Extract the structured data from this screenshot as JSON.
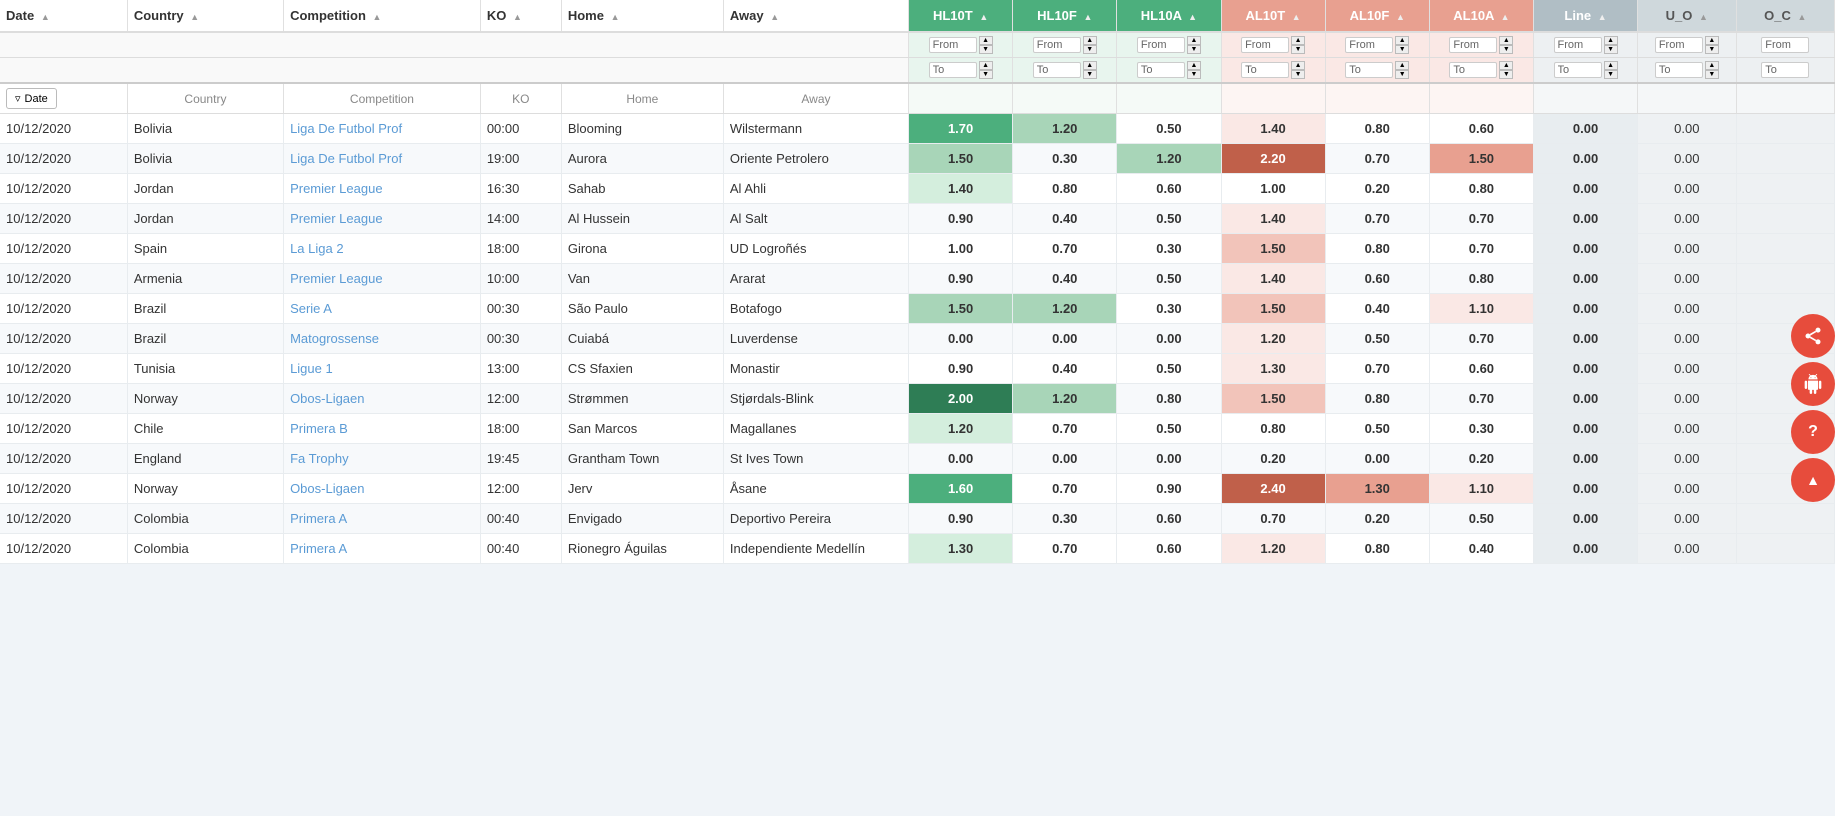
{
  "columns": {
    "date": "Date",
    "country": "Country",
    "competition": "Competition",
    "ko": "KO",
    "home": "Home",
    "away": "Away",
    "hl10t": "HL10T",
    "hl10f": "HL10F",
    "hl10a": "HL10A",
    "al10t": "AL10T",
    "al10f": "AL10F",
    "al10a": "AL10A",
    "line": "Line",
    "uo": "U_O",
    "oc": "O_C"
  },
  "filter": {
    "date_label": "Date",
    "from_label": "From",
    "to_label": "To"
  },
  "rows": [
    {
      "date": "10/12/2020",
      "country": "Bolivia",
      "competition": "Liga De Futbol Prof",
      "ko": "00:00",
      "home": "Blooming",
      "away": "Wilstermann",
      "hl10t": "1.70",
      "hl10f": "1.20",
      "hl10a": "0.50",
      "al10t": "1.40",
      "al10f": "0.80",
      "al10a": "0.60",
      "line": "0.00",
      "uo": "0.00",
      "oc": "",
      "hl10t_class": "hl-med-green",
      "hl10f_class": "hl-light-green",
      "hl10a_class": "",
      "al10t_class": "al-very-light-orange",
      "al10f_class": "",
      "al10a_class": ""
    },
    {
      "date": "10/12/2020",
      "country": "Bolivia",
      "competition": "Liga De Futbol Prof",
      "ko": "19:00",
      "home": "Aurora",
      "away": "Oriente Petrolero",
      "hl10t": "1.50",
      "hl10f": "0.30",
      "hl10a": "1.20",
      "al10t": "2.20",
      "al10f": "0.70",
      "al10a": "1.50",
      "line": "0.00",
      "uo": "0.00",
      "oc": "",
      "hl10t_class": "hl-light-green",
      "hl10f_class": "",
      "hl10a_class": "hl-light-green",
      "al10t_class": "al-dark-orange",
      "al10f_class": "",
      "al10a_class": "al-med-orange"
    },
    {
      "date": "10/12/2020",
      "country": "Jordan",
      "competition": "Premier League",
      "ko": "16:30",
      "home": "Sahab",
      "away": "Al Ahli",
      "hl10t": "1.40",
      "hl10f": "0.80",
      "hl10a": "0.60",
      "al10t": "1.00",
      "al10f": "0.20",
      "al10a": "0.80",
      "line": "0.00",
      "uo": "0.00",
      "oc": "",
      "hl10t_class": "hl-very-light-green",
      "hl10f_class": "",
      "hl10a_class": "",
      "al10t_class": "",
      "al10f_class": "",
      "al10a_class": ""
    },
    {
      "date": "10/12/2020",
      "country": "Jordan",
      "competition": "Premier League",
      "ko": "14:00",
      "home": "Al Hussein",
      "away": "Al Salt",
      "hl10t": "0.90",
      "hl10f": "0.40",
      "hl10a": "0.50",
      "al10t": "1.40",
      "al10f": "0.70",
      "al10a": "0.70",
      "line": "0.00",
      "uo": "0.00",
      "oc": "",
      "hl10t_class": "",
      "hl10f_class": "",
      "hl10a_class": "",
      "al10t_class": "al-very-light-orange",
      "al10f_class": "",
      "al10a_class": ""
    },
    {
      "date": "10/12/2020",
      "country": "Spain",
      "competition": "La Liga 2",
      "ko": "18:00",
      "home": "Girona",
      "away": "UD Logroñés",
      "hl10t": "1.00",
      "hl10f": "0.70",
      "hl10a": "0.30",
      "al10t": "1.50",
      "al10f": "0.80",
      "al10a": "0.70",
      "line": "0.00",
      "uo": "0.00",
      "oc": "",
      "hl10t_class": "",
      "hl10f_class": "",
      "hl10a_class": "",
      "al10t_class": "al-light-orange",
      "al10f_class": "",
      "al10a_class": ""
    },
    {
      "date": "10/12/2020",
      "country": "Armenia",
      "competition": "Premier League",
      "ko": "10:00",
      "home": "Van",
      "away": "Ararat",
      "hl10t": "0.90",
      "hl10f": "0.40",
      "hl10a": "0.50",
      "al10t": "1.40",
      "al10f": "0.60",
      "al10a": "0.80",
      "line": "0.00",
      "uo": "0.00",
      "oc": "",
      "hl10t_class": "",
      "hl10f_class": "",
      "hl10a_class": "",
      "al10t_class": "al-very-light-orange",
      "al10f_class": "",
      "al10a_class": ""
    },
    {
      "date": "10/12/2020",
      "country": "Brazil",
      "competition": "Serie A",
      "ko": "00:30",
      "home": "São Paulo",
      "away": "Botafogo",
      "hl10t": "1.50",
      "hl10f": "1.20",
      "hl10a": "0.30",
      "al10t": "1.50",
      "al10f": "0.40",
      "al10a": "1.10",
      "line": "0.00",
      "uo": "0.00",
      "oc": "",
      "hl10t_class": "hl-light-green",
      "hl10f_class": "hl-light-green",
      "hl10a_class": "",
      "al10t_class": "al-light-orange",
      "al10f_class": "",
      "al10a_class": "al-very-light-orange"
    },
    {
      "date": "10/12/2020",
      "country": "Brazil",
      "competition": "Matogrossense",
      "ko": "00:30",
      "home": "Cuiabá",
      "away": "Luverdense",
      "hl10t": "0.00",
      "hl10f": "0.00",
      "hl10a": "0.00",
      "al10t": "1.20",
      "al10f": "0.50",
      "al10a": "0.70",
      "line": "0.00",
      "uo": "0.00",
      "oc": "",
      "hl10t_class": "",
      "hl10f_class": "",
      "hl10a_class": "",
      "al10t_class": "al-very-light-orange",
      "al10f_class": "",
      "al10a_class": ""
    },
    {
      "date": "10/12/2020",
      "country": "Tunisia",
      "competition": "Ligue 1",
      "ko": "13:00",
      "home": "CS Sfaxien",
      "away": "Monastir",
      "hl10t": "0.90",
      "hl10f": "0.40",
      "hl10a": "0.50",
      "al10t": "1.30",
      "al10f": "0.70",
      "al10a": "0.60",
      "line": "0.00",
      "uo": "0.00",
      "oc": "",
      "hl10t_class": "",
      "hl10f_class": "",
      "hl10a_class": "",
      "al10t_class": "al-very-light-orange",
      "al10f_class": "",
      "al10a_class": ""
    },
    {
      "date": "10/12/2020",
      "country": "Norway",
      "competition": "Obos-Ligaen",
      "ko": "12:00",
      "home": "Strømmen",
      "away": "Stjørdals-Blink",
      "hl10t": "2.00",
      "hl10f": "1.20",
      "hl10a": "0.80",
      "al10t": "1.50",
      "al10f": "0.80",
      "al10a": "0.70",
      "line": "0.00",
      "uo": "0.00",
      "oc": "",
      "hl10t_class": "hl-dark-green",
      "hl10f_class": "hl-light-green",
      "hl10a_class": "",
      "al10t_class": "al-light-orange",
      "al10f_class": "",
      "al10a_class": ""
    },
    {
      "date": "10/12/2020",
      "country": "Chile",
      "competition": "Primera B",
      "ko": "18:00",
      "home": "San Marcos",
      "away": "Magallanes",
      "hl10t": "1.20",
      "hl10f": "0.70",
      "hl10a": "0.50",
      "al10t": "0.80",
      "al10f": "0.50",
      "al10a": "0.30",
      "line": "0.00",
      "uo": "0.00",
      "oc": "",
      "hl10t_class": "hl-very-light-green",
      "hl10f_class": "",
      "hl10a_class": "",
      "al10t_class": "",
      "al10f_class": "",
      "al10a_class": ""
    },
    {
      "date": "10/12/2020",
      "country": "England",
      "competition": "Fa Trophy",
      "ko": "19:45",
      "home": "Grantham Town",
      "away": "St Ives Town",
      "hl10t": "0.00",
      "hl10f": "0.00",
      "hl10a": "0.00",
      "al10t": "0.20",
      "al10f": "0.00",
      "al10a": "0.20",
      "line": "0.00",
      "uo": "0.00",
      "oc": "",
      "hl10t_class": "",
      "hl10f_class": "",
      "hl10a_class": "",
      "al10t_class": "",
      "al10f_class": "",
      "al10a_class": ""
    },
    {
      "date": "10/12/2020",
      "country": "Norway",
      "competition": "Obos-Ligaen",
      "ko": "12:00",
      "home": "Jerv",
      "away": "Åsane",
      "hl10t": "1.60",
      "hl10f": "0.70",
      "hl10a": "0.90",
      "al10t": "2.40",
      "al10f": "1.30",
      "al10a": "1.10",
      "line": "0.00",
      "uo": "0.00",
      "oc": "",
      "hl10t_class": "hl-med-green",
      "hl10f_class": "",
      "hl10a_class": "",
      "al10t_class": "al-dark-orange",
      "al10f_class": "al-med-orange",
      "al10a_class": "al-very-light-orange"
    },
    {
      "date": "10/12/2020",
      "country": "Colombia",
      "competition": "Primera A",
      "ko": "00:40",
      "home": "Envigado",
      "away": "Deportivo Pereira",
      "hl10t": "0.90",
      "hl10f": "0.30",
      "hl10a": "0.60",
      "al10t": "0.70",
      "al10f": "0.20",
      "al10a": "0.50",
      "line": "0.00",
      "uo": "0.00",
      "oc": "",
      "hl10t_class": "",
      "hl10f_class": "",
      "hl10a_class": "",
      "al10t_class": "",
      "al10f_class": "",
      "al10a_class": ""
    },
    {
      "date": "10/12/2020",
      "country": "Colombia",
      "competition": "Primera A",
      "ko": "00:40",
      "home": "Rionegro Águilas",
      "away": "Independiente Medellín",
      "hl10t": "1.30",
      "hl10f": "0.70",
      "hl10a": "0.60",
      "al10t": "1.20",
      "al10f": "0.80",
      "al10a": "0.40",
      "line": "0.00",
      "uo": "0.00",
      "oc": "",
      "hl10t_class": "hl-very-light-green",
      "hl10f_class": "",
      "hl10a_class": "",
      "al10t_class": "al-very-light-orange",
      "al10f_class": "",
      "al10a_class": ""
    }
  ],
  "side_buttons": {
    "share": "⤢",
    "android": "🤖",
    "help": "?",
    "up": "▲"
  }
}
